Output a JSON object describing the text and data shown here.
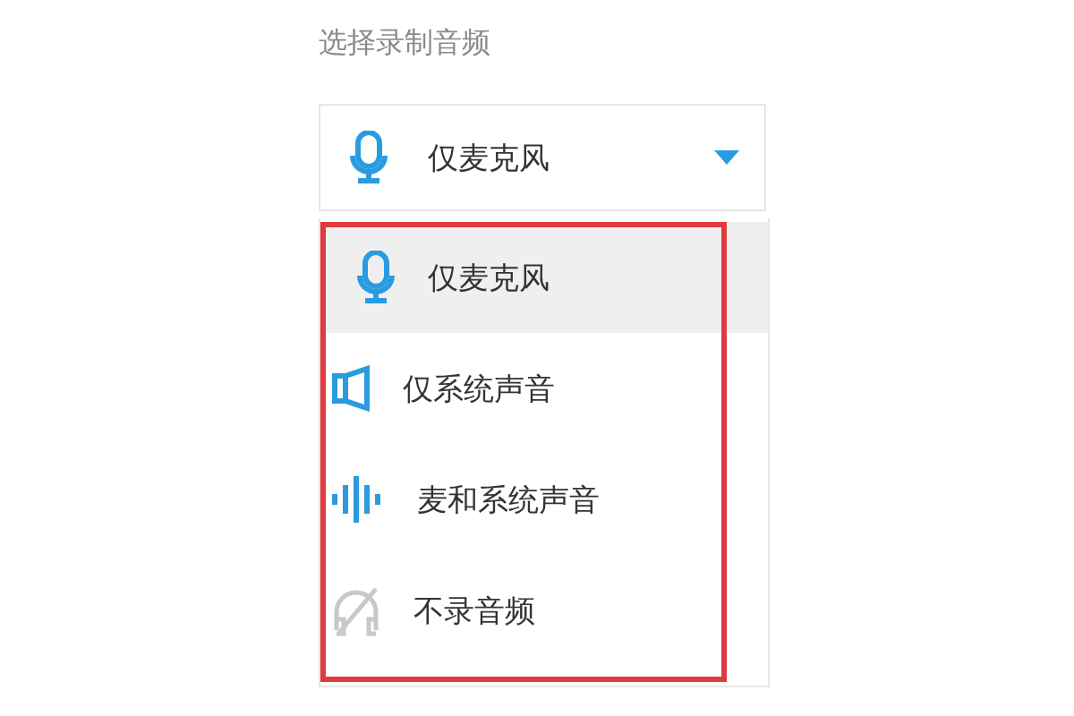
{
  "label": "选择录制音频",
  "dropdown": {
    "value": "仅麦克风",
    "kind": "mic"
  },
  "options": [
    {
      "label": "仅麦克风",
      "kind": "mic",
      "selected": true
    },
    {
      "label": "仅系统声音",
      "kind": "speaker",
      "selected": false
    },
    {
      "label": "麦和系统声音",
      "kind": "wave",
      "selected": false
    },
    {
      "label": "不录音频",
      "kind": "none",
      "selected": false
    }
  ],
  "annotation": {
    "kind": "highlight"
  }
}
